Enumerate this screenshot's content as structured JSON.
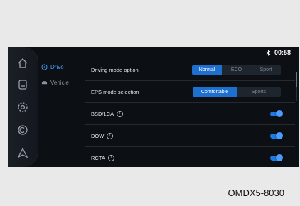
{
  "status_bar": {
    "icon": "bluetooth-icon",
    "time": "00:58"
  },
  "side_rail": {
    "icons": [
      "home-icon",
      "car-settings-icon",
      "gear-icon",
      "media-icon",
      "navigation-icon"
    ]
  },
  "sub_nav": {
    "items": [
      {
        "label": "Drive",
        "icon": "steering-wheel-icon",
        "active": true
      },
      {
        "label": "Vehicle",
        "icon": "car-icon",
        "active": false
      }
    ]
  },
  "settings": {
    "driving_mode": {
      "label": "Driving mode option",
      "options": [
        "Normal",
        "ECO",
        "Sport"
      ],
      "selected": "Normal"
    },
    "eps_mode": {
      "label": "EPS mode selection",
      "options": [
        "Comfortable",
        "Sports"
      ],
      "selected": "Comfortable"
    },
    "bsd_lca": {
      "label": "BSD/LCA",
      "enabled": true
    },
    "dow": {
      "label": "DOW",
      "enabled": true
    },
    "rcta": {
      "label": "RCTA",
      "enabled": true
    }
  },
  "info_symbol": "i",
  "colors": {
    "accent": "#1d6fd0",
    "toggle_on": "#4b9cff",
    "background": "#0c0f14"
  },
  "caption": "OMDX5-8030"
}
